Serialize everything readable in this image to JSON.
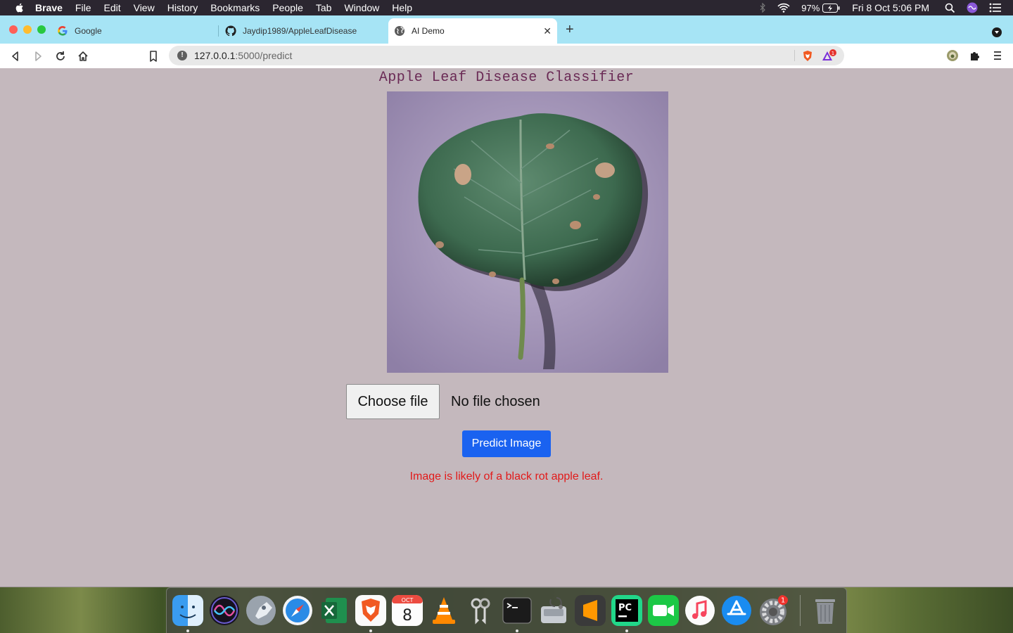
{
  "menubar": {
    "app": "Brave",
    "items": [
      "File",
      "Edit",
      "View",
      "History",
      "Bookmarks",
      "People",
      "Tab",
      "Window",
      "Help"
    ],
    "battery": "97%",
    "datetime": "Fri 8 Oct  5:06 PM"
  },
  "tabs": [
    {
      "title": "Google",
      "icon": "google-icon"
    },
    {
      "title": "Jaydip1989/AppleLeafDisease",
      "icon": "github-icon"
    },
    {
      "title": "AI Demo",
      "icon": "globe-icon",
      "active": true
    }
  ],
  "toolbar": {
    "url_host": "127.0.0.1",
    "url_path": ":5000/predict",
    "rewards_badge": "1"
  },
  "page": {
    "title": "Apple Leaf Disease Classifier",
    "choose_file_label": "Choose file",
    "file_status": "No file chosen",
    "predict_label": "Predict Image",
    "result": "Image is likely of a black rot apple leaf."
  },
  "dock": {
    "apps": [
      "Finder",
      "Siri",
      "Launchpad",
      "Safari",
      "Excel",
      "Brave",
      "Calendar",
      "VLC",
      "Keychain",
      "Terminal",
      "Disk Utility",
      "Sublime Text",
      "PyCharm",
      "FaceTime",
      "Music",
      "App Store",
      "System Preferences",
      "Trash"
    ],
    "calendar_month": "OCT",
    "calendar_day": "8",
    "prefs_badge": "1"
  },
  "colors": {
    "page_bg": "#c4b8bd",
    "title": "#6a2a55",
    "predict_button": "#1a62f0",
    "result_text": "#e21a1a",
    "tab_strip": "#a6e4f5"
  }
}
